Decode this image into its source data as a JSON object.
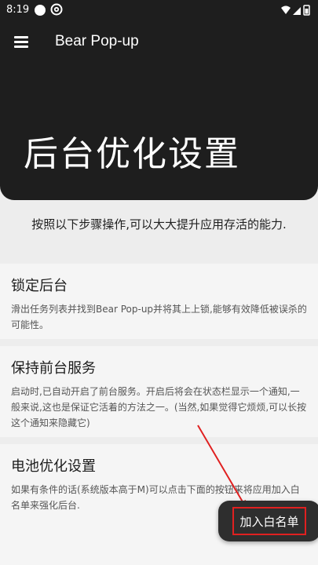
{
  "status_bar": {
    "time": "8:19"
  },
  "toolbar": {
    "title": "Bear Pop-up",
    "menu_icon": "hamburger-menu-icon"
  },
  "hero": {
    "title": "后台优化设置"
  },
  "intro": "按照以下步骤操作,可以大大提升应用存活的能力.",
  "cards": [
    {
      "title": "锁定后台",
      "text": "滑出任务列表并找到Bear Pop-up并将其上上锁,能够有效降低被误杀的可能性。"
    },
    {
      "title": "保持前台服务",
      "text": "启动时,已自动开启了前台服务。开启后将会在状态栏显示一个通知,一般来说,这也是保证它活着的方法之一。(当然,如果觉得它烦烦,可以长按这个通知来隐藏它)"
    },
    {
      "title": "电池优化设置",
      "text": "如果有条件的话(系统版本高于M)可以点击下面的按钮来将应用加入白名单来强化后台."
    }
  ],
  "whitelist_button": {
    "label": "加入白名单"
  },
  "colors": {
    "header_bg": "#1e1e1e",
    "page_bg": "#ededed",
    "card_bg": "#f5f5f5",
    "annotation_red": "#e02020"
  }
}
